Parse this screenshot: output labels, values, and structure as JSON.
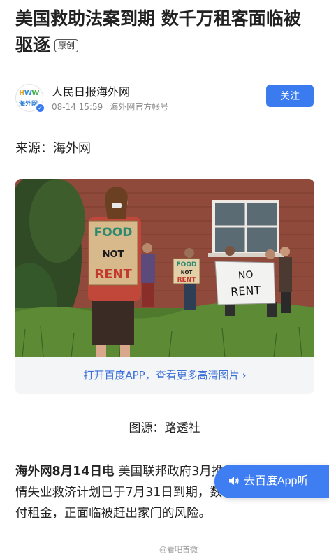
{
  "article": {
    "title": "美国救助法案到期 数千万租客面临被驱逐",
    "badge": "原创"
  },
  "author": {
    "name": "人民日报海外网",
    "date": "08-14 15:59",
    "account_type": "海外网官方帐号",
    "follow_label": "关注",
    "logo_letters": "HWW",
    "logo_text": "海外网",
    "verified_icon": "verified-check-icon"
  },
  "source_line": "来源：海外网",
  "image": {
    "sign1_line1": "FOOD",
    "sign1_line2": "NOT",
    "sign1_line3": "RENT",
    "sign2_line1": "FOOD",
    "sign2_line2": "NOT",
    "sign2_line3": "RENT",
    "banner_line1": "NO",
    "banner_line2": "RENT",
    "open_app_label": "打开百度APP，查看更多高清图片",
    "chevron": "›"
  },
  "caption": "图源：路透社",
  "body": {
    "lead_bold": "海外网8月14日电",
    "text": " 美国联邦政府3月推出的新冠肺炎疫情失业救济计划已于7月31日到期，数千万租客无力支付租金，正面临被赶出家门的风险。"
  },
  "listen": {
    "label": "去百度App听",
    "icon": "speaker-icon"
  },
  "watermark": "@看吧首微"
}
